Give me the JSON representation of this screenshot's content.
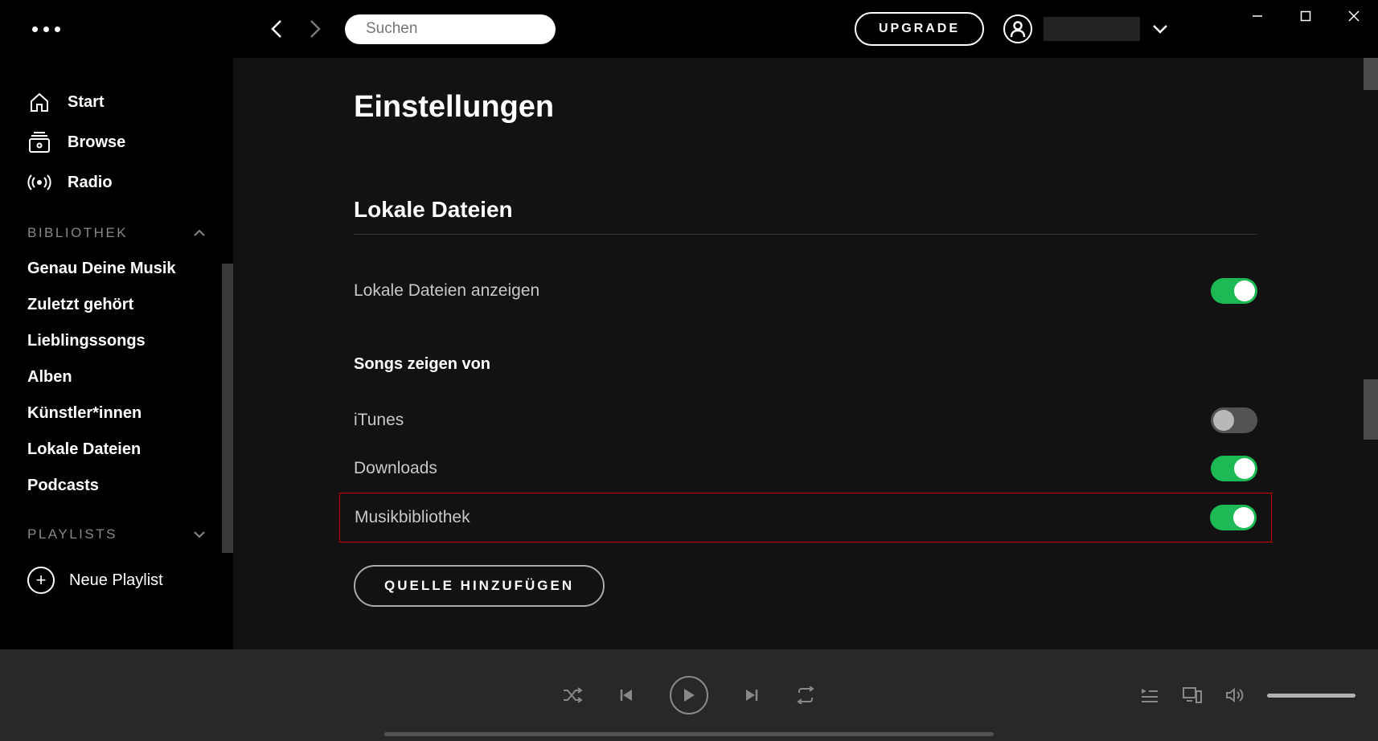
{
  "search_placeholder": "Suchen",
  "upgrade_label": "UPGRADE",
  "sidebar": {
    "nav": [
      {
        "label": "Start"
      },
      {
        "label": "Browse"
      },
      {
        "label": "Radio"
      }
    ],
    "library_header": "BIBLIOTHEK",
    "library_items": [
      "Genau Deine Musik",
      "Zuletzt gehört",
      "Lieblingssongs",
      "Alben",
      "Künstler*innen",
      "Lokale Dateien",
      "Podcasts"
    ],
    "playlists_header": "PLAYLISTS",
    "new_playlist": "Neue Playlist"
  },
  "settings": {
    "title": "Einstellungen",
    "local_files_section": "Lokale Dateien",
    "show_local_files": "Lokale Dateien anzeigen",
    "songs_from": "Songs zeigen von",
    "sources": {
      "itunes": "iTunes",
      "downloads": "Downloads",
      "music_library": "Musikbibliothek"
    },
    "add_source": "QUELLE HINZUFÜGEN"
  }
}
